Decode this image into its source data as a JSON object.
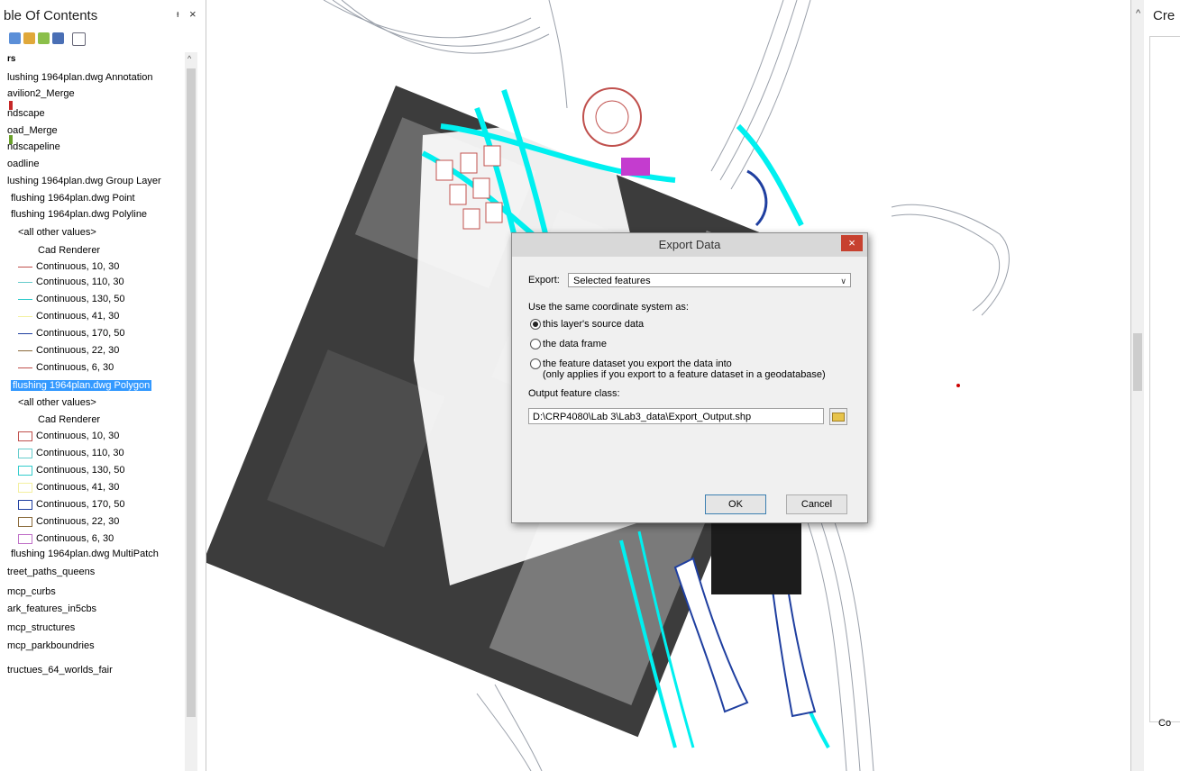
{
  "toc": {
    "title": "ble Of Contents",
    "pin": "ᵻ",
    "close": "×",
    "layers_heading": "rs",
    "items": [
      {
        "label": "lushing 1964plan.dwg Annotation"
      },
      {
        "label": "avilion2_Merge"
      },
      {
        "label": "ndscape"
      },
      {
        "label": "oad_Merge"
      },
      {
        "label": "ndscapeline"
      },
      {
        "label": "oadline"
      },
      {
        "label": "lushing 1964plan.dwg Group Layer"
      },
      {
        "label": "flushing 1964plan.dwg Point"
      },
      {
        "label": "flushing 1964plan.dwg Polyline"
      },
      {
        "label": "<all other values>"
      },
      {
        "label": "Cad Renderer"
      },
      {
        "label": "Continuous, 10, 30",
        "color": "#c0504d"
      },
      {
        "label": "Continuous, 110, 30",
        "color": "#66cccc"
      },
      {
        "label": "Continuous, 130, 50",
        "color": "#33cccc"
      },
      {
        "label": "Continuous, 41, 30",
        "color": "#f3f0a0"
      },
      {
        "label": "Continuous, 170, 50",
        "color": "#1f3fa0"
      },
      {
        "label": "Continuous, 22, 30",
        "color": "#8a6a3a"
      },
      {
        "label": "Continuous, 6, 30",
        "color": "#c0504d"
      },
      {
        "label": "flushing 1964plan.dwg Polygon"
      },
      {
        "label": "<all other values>"
      },
      {
        "label": "Cad Renderer"
      },
      {
        "label": "Continuous, 10, 30",
        "color": "#c0504d"
      },
      {
        "label": "Continuous, 110, 30",
        "color": "#66cccc"
      },
      {
        "label": "Continuous, 130, 50",
        "color": "#33cccc"
      },
      {
        "label": "Continuous, 41, 30",
        "color": "#f3f0a0"
      },
      {
        "label": "Continuous, 170, 50",
        "color": "#1f3fa0"
      },
      {
        "label": "Continuous, 22, 30",
        "color": "#8a6a3a"
      },
      {
        "label": "Continuous, 6, 30",
        "color": "#c070c8"
      },
      {
        "label": "flushing 1964plan.dwg MultiPatch"
      },
      {
        "label": "treet_paths_queens"
      },
      {
        "label": "mcp_curbs"
      },
      {
        "label": "ark_features_in5cbs"
      },
      {
        "label": "mcp_structures"
      },
      {
        "label": "mcp_parkboundries"
      },
      {
        "label": "tructues_64_worlds_fair"
      }
    ]
  },
  "right_panel": {
    "title": "Cre",
    "caret": "^",
    "bottom_label": "Co"
  },
  "dialog": {
    "title": "Export Data",
    "close": "×",
    "export_label": "Export:",
    "export_value": "Selected features",
    "coord_label": "Use the same coordinate system as:",
    "options": [
      "this layer's source data",
      "the data frame",
      "the feature dataset you export the data into"
    ],
    "option3_note": "(only applies if you export to a feature dataset in a geodatabase)",
    "selected_option": "this layer's source data",
    "output_label": "Output feature class:",
    "output_value": "D:\\CRP4080\\Lab 3\\Lab3_data\\Export_Output.shp",
    "ok": "OK",
    "cancel": "Cancel"
  },
  "colors": {
    "selection": "#3399ff",
    "close_button": "#c7412f",
    "cyan_features": "#00f0f0"
  }
}
